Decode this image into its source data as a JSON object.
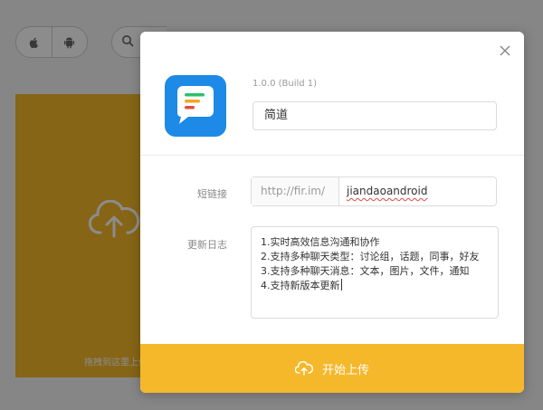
{
  "background": {
    "platform_tabs": [
      {
        "icon": "apple-icon"
      },
      {
        "icon": "android-icon"
      }
    ],
    "search_icon": "search-icon",
    "upload_hint": "拖拽到这里上传",
    "upload_color": "#f5b82b"
  },
  "modal": {
    "version": "1.0.0 (Build 1)",
    "app_name": "简道",
    "short_link_label": "短链接",
    "short_link_prefix": "http://fir.im/",
    "short_link_value": "jiandaoandroid",
    "changelog_label": "更新日志",
    "changelog_lines": [
      "1.实时高效信息沟通和协作",
      "2.支持多种聊天类型：讨论组，话题，同事，好友",
      "3.支持多种聊天消息：文本，图片，文件，通知",
      "4.支持新版本更新"
    ],
    "upload_button_label": "开始上传",
    "accent_color": "#f5b82b",
    "icon_color": "#1c8ae6"
  }
}
